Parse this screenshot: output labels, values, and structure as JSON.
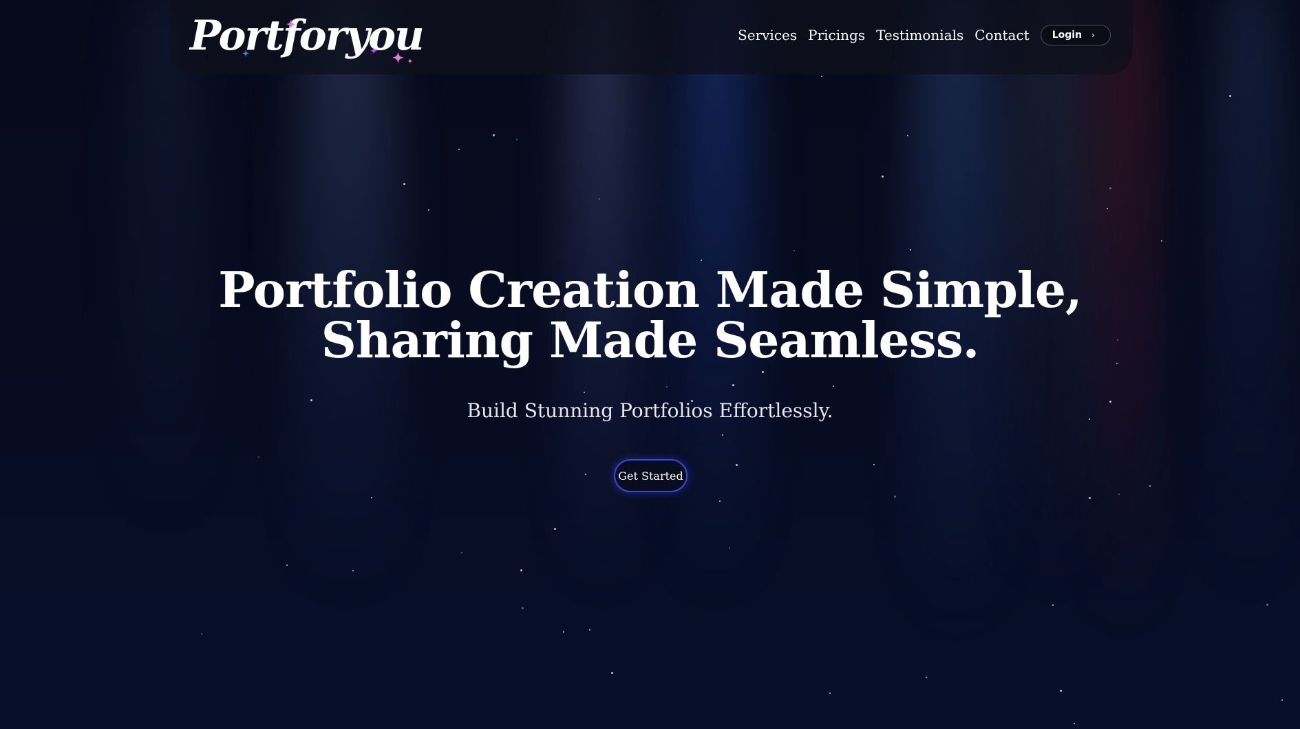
{
  "brand": {
    "name": "Portforyou",
    "sparkle_colors": [
      "#5a72e0",
      "#e07ad8",
      "#b05ce8"
    ]
  },
  "nav": {
    "links": [
      "Services",
      "Pricings",
      "Testimonials",
      "Contact"
    ],
    "login_label": "Login",
    "login_icon": "chevron-right-icon"
  },
  "hero": {
    "title_line1": "Portfolio Creation Made Simple,",
    "title_line2": "Sharing Made Seamless.",
    "subtitle": "Build Stunning Portfolios Effortlessly.",
    "cta_label": "Get Started"
  },
  "theme": {
    "background": "#050816",
    "cta_border": "#3848d8"
  }
}
